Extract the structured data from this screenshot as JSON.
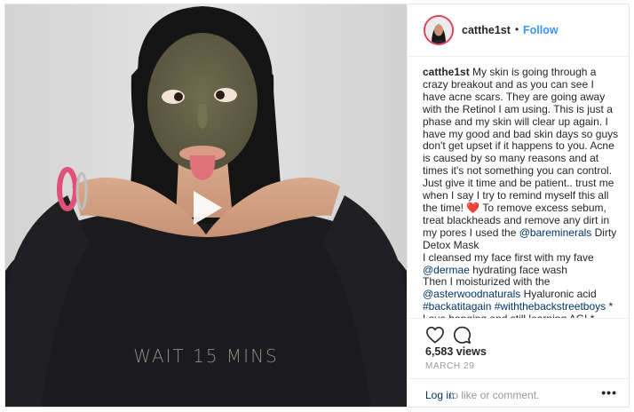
{
  "post": {
    "video": {
      "overlay_text": "WAIT 15 MINS"
    },
    "header": {
      "username": "catthe1st",
      "separator": "•",
      "follow_label": "Follow"
    },
    "caption": {
      "username": "catthe1st",
      "part1": " My skin is going through a crazy breakout and as you can see I have acne scars. They are going away with the Retinol I am using. This is just a phase and my skin will clear up again. I have my good and bad skin days so guys don't get upset if it happens to you. Acne is caused by so many reasons and at times it's not something you can control. Just give it time and be patient.. trust me when I say I try to remind myself this all the time! ",
      "heart": "❤️",
      "part2": " To remove excess sebum, treat blackheads and remove any dirt in my pores I used the ",
      "mention1": "@bareminerals",
      "part3": " Dirty Detox Mask",
      "part4": "I cleansed my face first with my fave ",
      "mention2": "@dermae",
      "part5": " hydrating face wash",
      "part6": "Then I moisturized with the ",
      "mention3": "@asterwoodnaturals",
      "part7": " Hyaluronic acid ",
      "hashtag1": "#backatitagain",
      "space": " ",
      "hashtag2": "#withthebackstreetboys",
      "part8": " * Love hanging and still learning AGL*"
    },
    "actions": {
      "like_icon": "heart-outline-icon",
      "comment_icon": "speech-bubble-icon"
    },
    "views": "6,583 views",
    "date": "MARCH 29",
    "footer": {
      "login_label": "Log in",
      "rest_text": " to like or comment.",
      "more_label": "•••"
    }
  }
}
